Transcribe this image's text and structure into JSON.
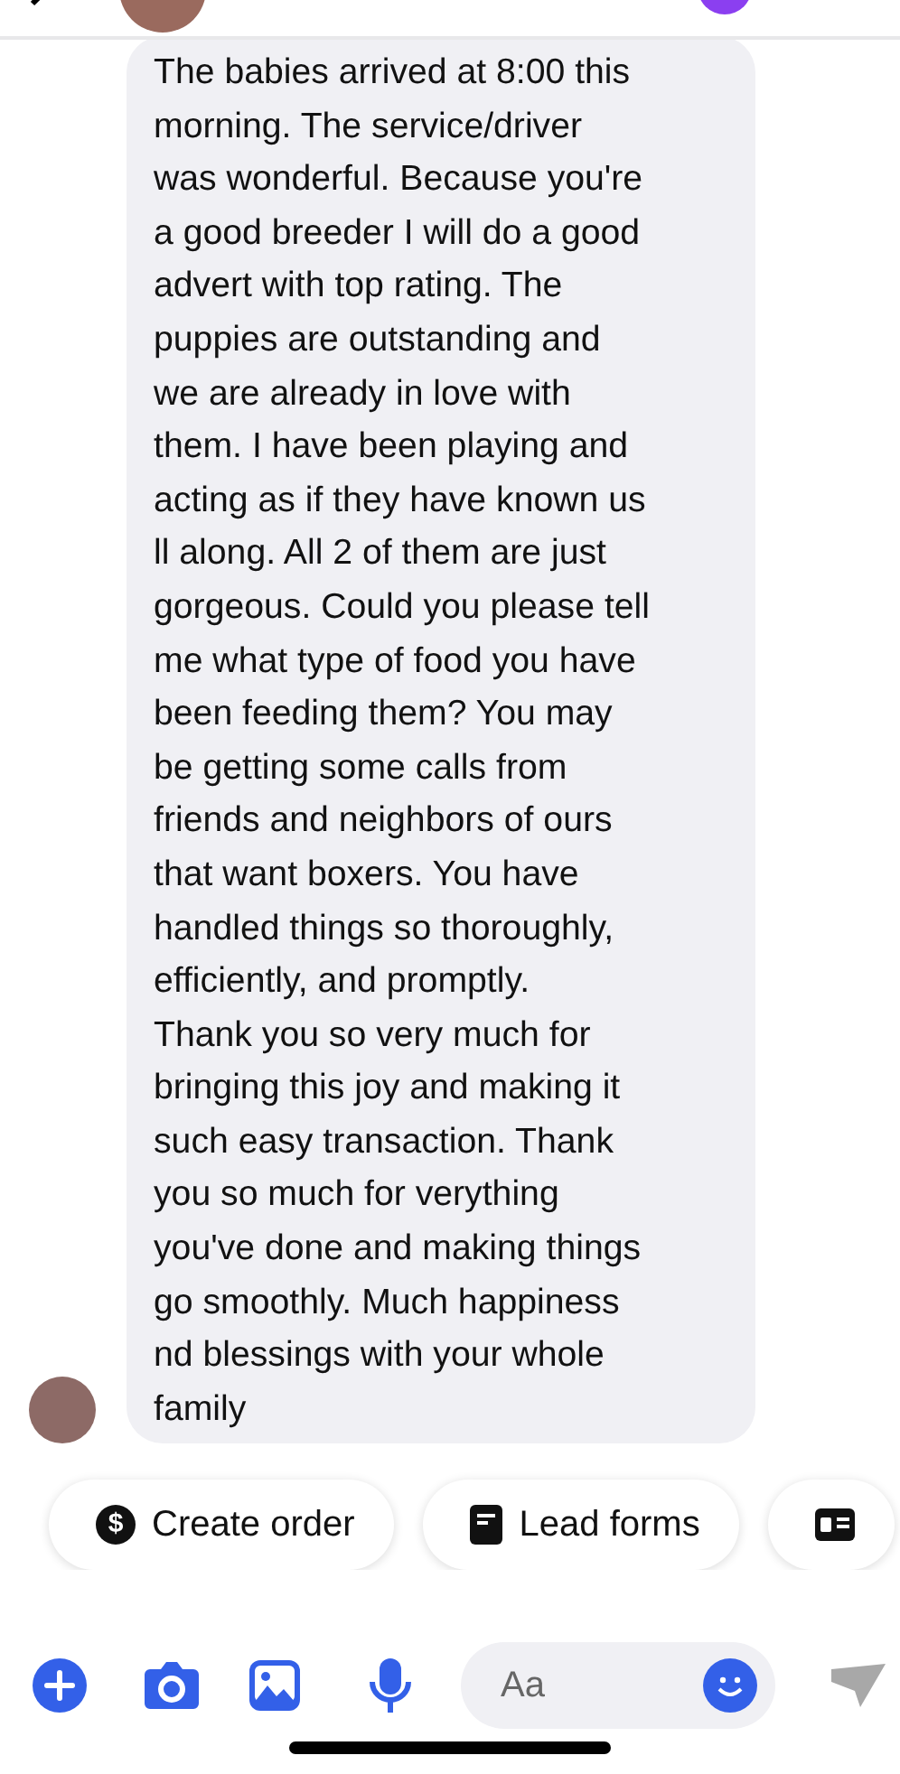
{
  "message": {
    "lines": [
      "The babies arrived at 8:00 this",
      "morning. The service/driver",
      "was wonderful. Because you're",
      "a good breeder I will do a good",
      "advert with top rating. The",
      "puppies are outstanding and",
      "we are already in love with",
      "them. I have been playing and",
      "acting as if they have known us",
      "ll along. All 2 of them are just",
      "gorgeous. Could you please tell",
      "me what type of food you have",
      "been feeding them? You may",
      "be getting some calls from",
      "friends and neighbors of ours",
      "that want boxers. You have",
      "handled things so thoroughly,",
      "efficiently, and promptly.",
      "Thank you so very much for",
      "bringing this joy and making it",
      "such easy transaction. Thank",
      "you so much for verything",
      "you've done and making things",
      "go smoothly. Much happiness",
      "nd blessings with your whole",
      "family"
    ]
  },
  "quick_replies": [
    {
      "kind": "dollar",
      "glyph": "$",
      "label": "Create order"
    },
    {
      "kind": "form",
      "label": "Lead forms"
    },
    {
      "kind": "card"
    }
  ],
  "composer": {
    "placeholder": "Aa"
  }
}
